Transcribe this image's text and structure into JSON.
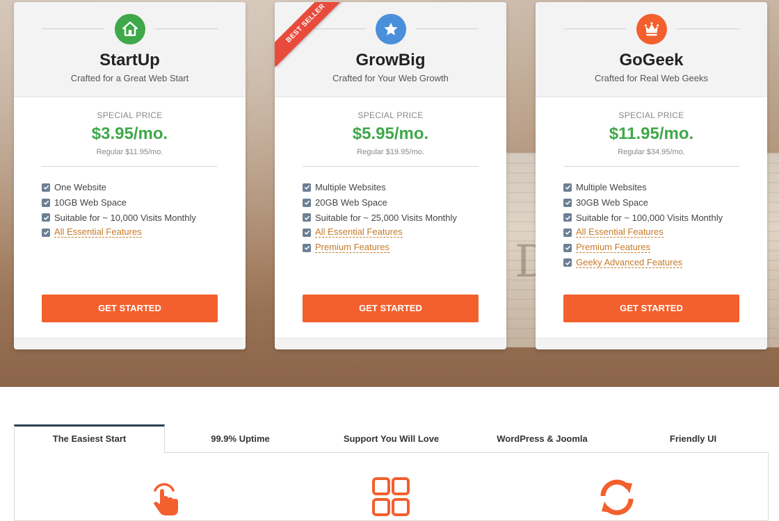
{
  "plans": [
    {
      "name": "StartUp",
      "subtitle": "Crafted for a Great Web Start",
      "icon": "home-icon",
      "icon_color": "#3fa84a",
      "special_label": "SPECIAL PRICE",
      "price": "$3.95/mo.",
      "regular": "Regular $11.95/mo.",
      "features": [
        {
          "text": "One Website",
          "link": false
        },
        {
          "text": "10GB Web Space",
          "link": false
        },
        {
          "text": "Suitable for ~ 10,000 Visits Monthly",
          "link": false
        },
        {
          "text": "All Essential Features",
          "link": true
        }
      ],
      "cta": "GET STARTED"
    },
    {
      "name": "GrowBig",
      "subtitle": "Crafted for Your Web Growth",
      "icon": "star-icon",
      "icon_color": "#4a8fd9",
      "ribbon": "BEST SELLER",
      "special_label": "SPECIAL PRICE",
      "price": "$5.95/mo.",
      "regular": "Regular $19.95/mo.",
      "features": [
        {
          "text": "Multiple Websites",
          "link": false
        },
        {
          "text": "20GB Web Space",
          "link": false
        },
        {
          "text": "Suitable for ~ 25,000 Visits Monthly",
          "link": false
        },
        {
          "text": "All Essential Features",
          "link": true
        },
        {
          "text": "Premium Features",
          "link": true
        }
      ],
      "cta": "GET STARTED"
    },
    {
      "name": "GoGeek",
      "subtitle": "Crafted for Real Web Geeks",
      "icon": "crown-icon",
      "icon_color": "#f35f2d",
      "special_label": "SPECIAL PRICE",
      "price": "$11.95/mo.",
      "regular": "Regular $34.95/mo.",
      "features": [
        {
          "text": "Multiple Websites",
          "link": false
        },
        {
          "text": "30GB Web Space",
          "link": false
        },
        {
          "text": "Suitable for ~ 100,000 Visits Monthly",
          "link": false
        },
        {
          "text": "All Essential Features",
          "link": true
        },
        {
          "text": "Premium Features",
          "link": true
        },
        {
          "text": "Geeky Advanced Features",
          "link": true
        }
      ],
      "cta": "GET STARTED"
    }
  ],
  "tabs": [
    {
      "label": "The Easiest Start",
      "active": true
    },
    {
      "label": "99.9% Uptime",
      "active": false
    },
    {
      "label": "Support You Will Love",
      "active": false
    },
    {
      "label": "WordPress & Joomla",
      "active": false
    },
    {
      "label": "Friendly UI",
      "active": false
    }
  ],
  "feature_icons": [
    "tap-hand-icon",
    "grid-apps-icon",
    "refresh-icon"
  ],
  "colors": {
    "accent": "#f35f2d",
    "price_green": "#3fa84a",
    "link_orange": "#c67a2a",
    "check_slate": "#6c7f94",
    "tab_active_border": "#2c3e50"
  }
}
